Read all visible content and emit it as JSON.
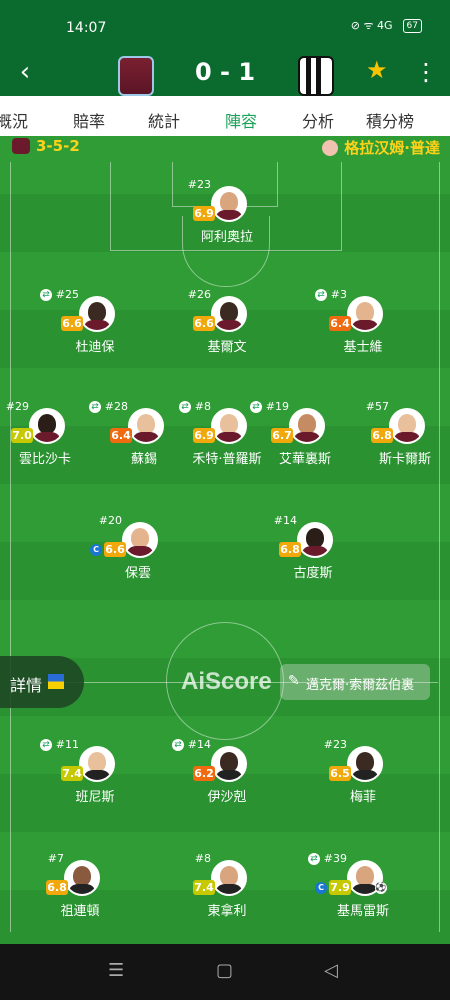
{
  "status_bar": {
    "time": "14:07",
    "icons_text": "⊘ ᯤ 4G",
    "battery": "67"
  },
  "header": {
    "score": "0 - 1",
    "back_icon": "chevron-left-icon",
    "favorite_icon": "star-icon",
    "more_icon": "more-vertical-icon"
  },
  "tabs": [
    {
      "label": "概況"
    },
    {
      "label": "賠率"
    },
    {
      "label": "統計"
    },
    {
      "label": "陣容",
      "active": true
    },
    {
      "label": "分析"
    },
    {
      "label": "積分榜"
    }
  ],
  "formation": {
    "home": "3-5-2",
    "away_label": "格拉汉姆·普達"
  },
  "players": [
    {
      "number": "#23",
      "rating": "6.9",
      "name": "阿利奧拉",
      "color": "#f0a80a"
    },
    {
      "number": "#25",
      "rating": "6.6",
      "name": "杜迪保",
      "color": "#f0a80a",
      "sub": true
    },
    {
      "number": "#26",
      "rating": "6.6",
      "name": "基爾文",
      "color": "#f0a80a"
    },
    {
      "number": "#3",
      "rating": "6.4",
      "name": "基士維",
      "color": "#f06a10",
      "sub": true
    },
    {
      "number": "#29",
      "rating": "7.0",
      "name": "雲比沙卡",
      "color": "#c6c800"
    },
    {
      "number": "#28",
      "rating": "6.4",
      "name": "蘇錫",
      "color": "#f06a10",
      "sub": true
    },
    {
      "number": "#8",
      "rating": "6.9",
      "name": "禾特·普羅斯",
      "color": "#f0a80a",
      "sub": true
    },
    {
      "number": "#19",
      "rating": "6.7",
      "name": "艾華裏斯",
      "color": "#f0a80a",
      "sub": true
    },
    {
      "number": "#57",
      "rating": "6.8",
      "name": "斯卡爾斯",
      "color": "#f0a80a"
    },
    {
      "number": "#20",
      "rating": "6.6",
      "name": "保雲",
      "color": "#f0a80a",
      "captain": true
    },
    {
      "number": "#14",
      "rating": "6.8",
      "name": "古度斯",
      "color": "#f0a80a"
    },
    {
      "number": "#11",
      "rating": "7.4",
      "name": "班尼斯",
      "color": "#c6c800",
      "sub": true
    },
    {
      "number": "#14",
      "rating": "6.2",
      "name": "伊沙剋",
      "color": "#f06a10",
      "sub": true
    },
    {
      "number": "#23",
      "rating": "6.5",
      "name": "梅菲",
      "color": "#f0a80a"
    },
    {
      "number": "#7",
      "rating": "6.8",
      "name": "祖連頓",
      "color": "#f0a80a"
    },
    {
      "number": "#8",
      "rating": "7.4",
      "name": "東拿利",
      "color": "#c6c800"
    },
    {
      "number": "#39",
      "rating": "7.9",
      "name": "基馬雷斯",
      "color": "#c6c800",
      "sub": true,
      "captain": true,
      "goal": true
    }
  ],
  "overlay": {
    "details_label": "詳情",
    "watermark": "AiScore",
    "coach": "邁克爾·索爾茲伯裏"
  },
  "navbar": {
    "menu_icon": "☰",
    "home_icon": "▢",
    "back_icon": "◁"
  }
}
